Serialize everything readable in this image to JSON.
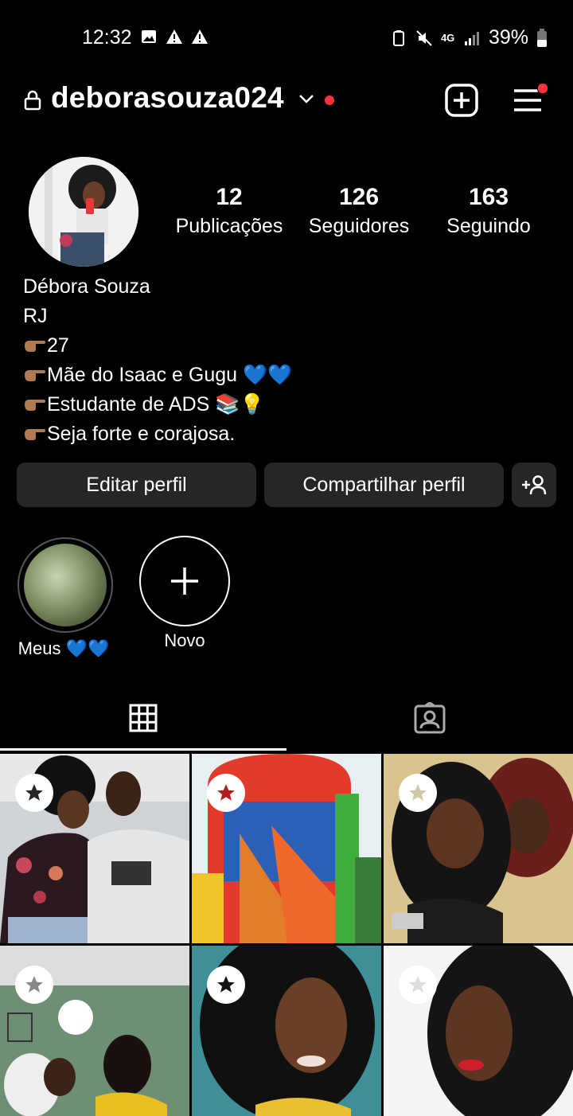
{
  "status_bar": {
    "time": "12:32",
    "battery": "39%",
    "network": "4G"
  },
  "header": {
    "username": "deborasouza024"
  },
  "profile": {
    "stats": [
      {
        "value": "12",
        "label": "Publicações"
      },
      {
        "value": "126",
        "label": "Seguidores"
      },
      {
        "value": "163",
        "label": "Seguindo"
      }
    ],
    "bio": {
      "name": "Débora Souza",
      "location": "RJ",
      "lines": [
        "27",
        "Mãe do Isaac e Gugu 💙💙",
        "Estudante de ADS 📚💡",
        "Seja forte e corajosa."
      ]
    }
  },
  "buttons": {
    "edit": "Editar perfil",
    "share": "Compartilhar perfil"
  },
  "highlights": [
    {
      "label": "Meus 💙💙"
    },
    {
      "label": "Novo"
    }
  ],
  "tabs": [
    {
      "icon": "grid-icon",
      "active": true
    },
    {
      "icon": "tagged-icon",
      "active": false
    }
  ],
  "posts": [
    {
      "star_color": "#262626"
    },
    {
      "star_color": "#b02020"
    },
    {
      "star_color": "#cfc9a8"
    },
    {
      "star_color": "#888888"
    },
    {
      "star_color": "#111111"
    },
    {
      "star_color": "#dddddd"
    }
  ]
}
